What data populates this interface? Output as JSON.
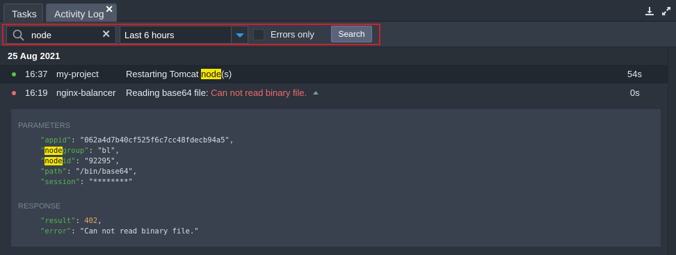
{
  "tabs": [
    {
      "label": "Tasks",
      "active": false
    },
    {
      "label": "Activity Log",
      "active": true
    }
  ],
  "toolbar": {
    "close_glyph": "✕",
    "download_icon": "download-icon",
    "expand_icon": "expand-icon"
  },
  "filter": {
    "search_value": "node",
    "clear_glyph": "✕",
    "period": "Last 6 hours",
    "errors_only_label": "Errors only",
    "errors_only_checked": false,
    "search_button": "Search"
  },
  "log": {
    "date": "25 Aug 2021",
    "entries": [
      {
        "status": "success",
        "status_color": "#57c44a",
        "time": "16:37",
        "project": "my-project",
        "message_pre": "Restarting Tomcat ",
        "message_hl": "node",
        "message_post": "(s)",
        "duration": "54s"
      },
      {
        "status": "error",
        "status_color": "#ef6b6b",
        "time": "16:19",
        "project": "nginx-balancer",
        "message_pre": "Reading base64 file: ",
        "message_err": "Can not read binary file.",
        "duration": "0s"
      }
    ],
    "details": {
      "parameters_title": "PARAMETERS",
      "response_title": "RESPONSE",
      "params": {
        "appid_key": "\"appid\"",
        "appid_val": "\"062a4d7b40cf525f6c7cc48fdecb94a5\"",
        "nodegroup_hl": "node",
        "nodegroup_key_rest": "group\"",
        "nodegroup_val": "\"bl\"",
        "nodeid_hl": "node",
        "nodeid_key_rest": "id\"",
        "nodeid_val": "\"92295\"",
        "path_key": "\"path\"",
        "path_val": "\"/bin/base64\"",
        "session_key": "\"session\"",
        "session_val": "\"********\""
      },
      "response": {
        "result_key": "\"result\"",
        "result_val": "402",
        "error_key": "\"error\"",
        "error_val": "\"Can not read binary file.\""
      }
    }
  }
}
